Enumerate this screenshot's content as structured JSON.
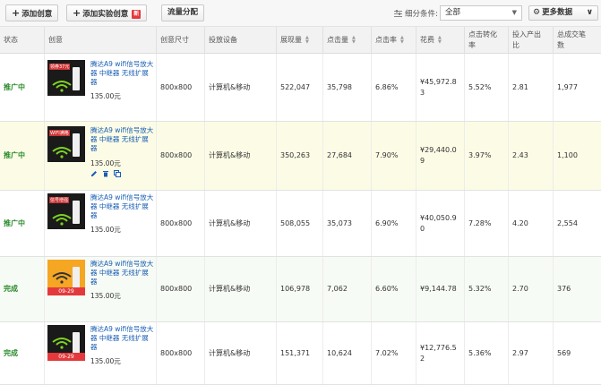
{
  "toolbar": {
    "add_creative": "添加创意",
    "add_test_creative": "添加实验创意",
    "new_badge": "新",
    "traffic_split": "流量分配",
    "filter_label": "细分条件:",
    "filter_value": "全部",
    "more_data": "更多数据"
  },
  "columns": [
    "状态",
    "创意",
    "创意尺寸",
    "投放设备",
    "展现量",
    "点击量",
    "点击率",
    "花费",
    "点击转化率",
    "投入产出比",
    "总成交笔数"
  ],
  "rows": [
    {
      "status": "推广中",
      "title": "腾达A9 wifi信号放大器 中继器 无线扩展器",
      "price": "135.00元",
      "size": "800x800",
      "device": "计算机&移动",
      "impressions": "522,047",
      "clicks": "35,798",
      "ctr": "6.86%",
      "cost": "¥45,972.83",
      "conv_rate": "5.52%",
      "roi": "2.81",
      "orders": "1,977",
      "thumb_banner": "领券37元"
    },
    {
      "status": "推广中",
      "title": "腾达A9 wifi信号放大器 中继器 无线扩展器",
      "price": "135.00元",
      "size": "800x800",
      "device": "计算机&移动",
      "impressions": "350,263",
      "clicks": "27,684",
      "ctr": "7.90%",
      "cost": "¥29,440.09",
      "conv_rate": "3.97%",
      "roi": "2.43",
      "orders": "1,100",
      "thumb_banner": "WIFI满格"
    },
    {
      "status": "推广中",
      "title": "腾达A9 wifi信号放大器 中继器 无线扩展器",
      "price": "135.00元",
      "size": "800x800",
      "device": "计算机&移动",
      "impressions": "508,055",
      "clicks": "35,073",
      "ctr": "6.90%",
      "cost": "¥40,050.90",
      "conv_rate": "7.28%",
      "roi": "4.20",
      "orders": "2,554",
      "thumb_banner": "信号增强"
    },
    {
      "status": "完成",
      "title": "腾达A9 wifi信号放大器 中继器 无线扩展器",
      "price": "135.00元",
      "size": "800x800",
      "device": "计算机&移动",
      "impressions": "106,978",
      "clicks": "7,062",
      "ctr": "6.60%",
      "cost": "¥9,144.78",
      "conv_rate": "5.32%",
      "roi": "2.70",
      "orders": "376",
      "thumb_date": "09-29"
    },
    {
      "status": "完成",
      "title": "腾达A9 wifi信号放大器 中继器 无线扩展器",
      "price": "135.00元",
      "size": "800x800",
      "device": "计算机&移动",
      "impressions": "151,371",
      "clicks": "10,624",
      "ctr": "7.02%",
      "cost": "¥12,776.52",
      "conv_rate": "5.36%",
      "roi": "2.97",
      "orders": "569",
      "thumb_date": "09-29"
    }
  ],
  "colors": {
    "status_green": "#2a8a2a",
    "link_blue": "#1a5fb4",
    "highlight_row": "#fcfce6",
    "badge_red": "#e4393c"
  }
}
